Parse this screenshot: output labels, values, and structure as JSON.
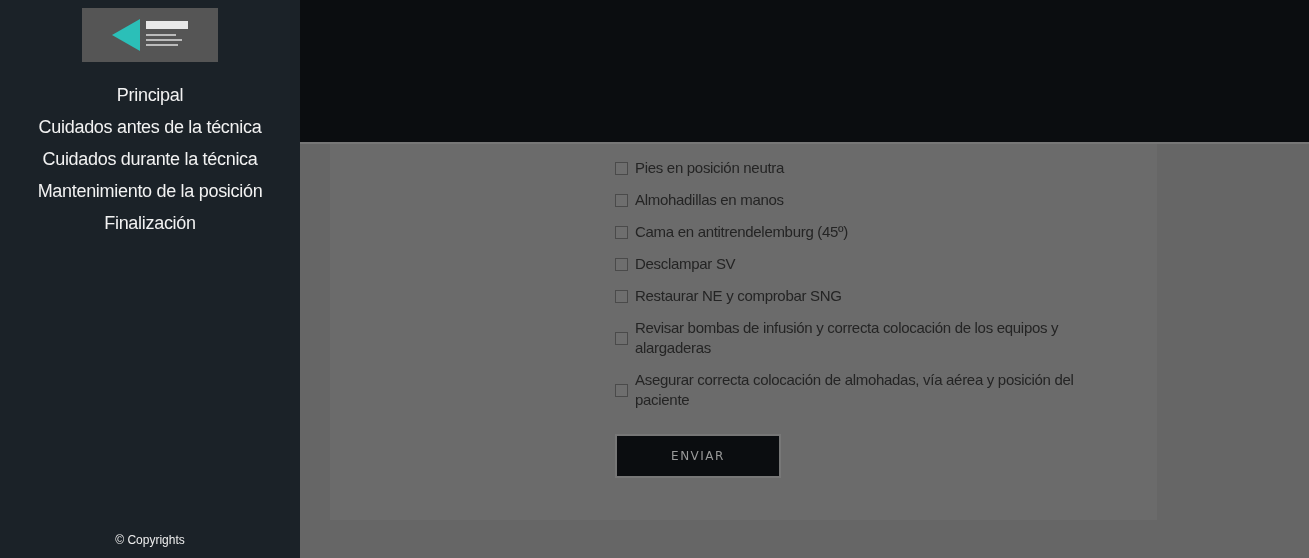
{
  "sidebar": {
    "items": [
      {
        "label": "Principal",
        "selected": false
      },
      {
        "label": "Cuidados antes de la técnica",
        "selected": false
      },
      {
        "label": "Cuidados durante la técnica",
        "selected": false
      },
      {
        "label": "Mantenimiento de la posición",
        "selected": false
      },
      {
        "label": "Finalización",
        "selected": false
      }
    ],
    "footer": "© Copyrights"
  },
  "checklist": [
    {
      "label": "Pies en posición neutra",
      "checked": false
    },
    {
      "label": "Almohadillas en manos",
      "checked": false
    },
    {
      "label": "Cama en antitrendelemburg (45º)",
      "checked": false
    },
    {
      "label": "Desclampar SV",
      "checked": false
    },
    {
      "label": "Restaurar NE y comprobar SNG",
      "checked": false
    },
    {
      "label": "Revisar bombas de infusión y correcta colocación de los equipos y alargaderas",
      "checked": false
    },
    {
      "label": "Asegurar correcta colocación de almohadas, vía aérea y posición del paciente",
      "checked": false
    }
  ],
  "submit_button": "ENVIAR"
}
